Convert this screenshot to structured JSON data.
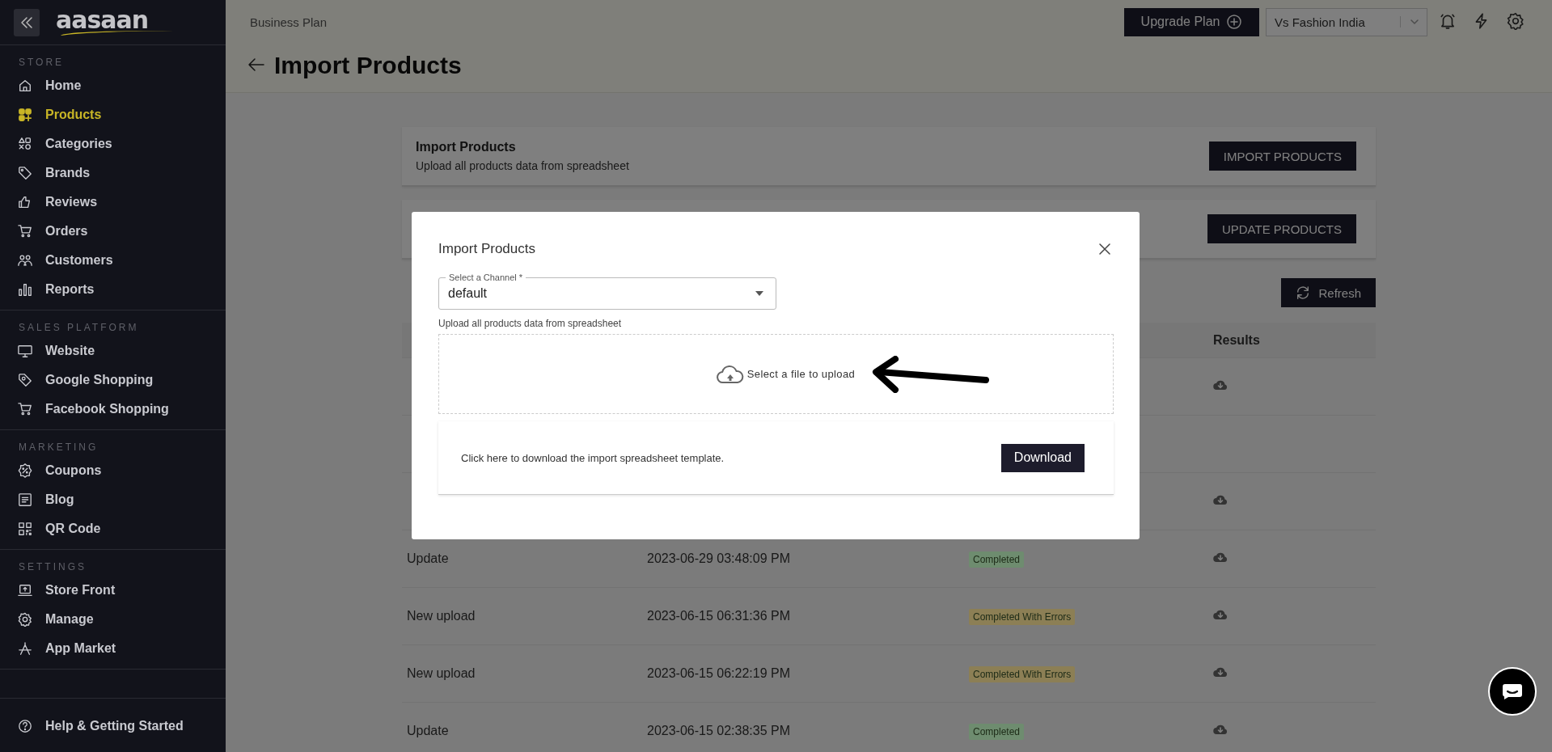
{
  "sidebar": {
    "logo": "aasaan",
    "sections": [
      {
        "title": "STORE",
        "items": [
          {
            "label": "Home",
            "selected": false
          },
          {
            "label": "Products",
            "selected": true
          },
          {
            "label": "Categories",
            "selected": false
          },
          {
            "label": "Brands",
            "selected": false
          },
          {
            "label": "Reviews",
            "selected": false
          },
          {
            "label": "Orders",
            "selected": false
          },
          {
            "label": "Customers",
            "selected": false
          },
          {
            "label": "Reports",
            "selected": false
          }
        ]
      },
      {
        "title": "SALES PLATFORM",
        "items": [
          {
            "label": "Website",
            "selected": false
          },
          {
            "label": "Google Shopping",
            "selected": false
          },
          {
            "label": "Facebook Shopping",
            "selected": false
          }
        ]
      },
      {
        "title": "MARKETING",
        "items": [
          {
            "label": "Coupons",
            "selected": false
          },
          {
            "label": "Blog",
            "selected": false
          },
          {
            "label": "QR Code",
            "selected": false
          }
        ]
      },
      {
        "title": "SETTINGS",
        "items": [
          {
            "label": "Store Front",
            "selected": false
          },
          {
            "label": "Manage",
            "selected": false
          },
          {
            "label": "App Market",
            "selected": false
          }
        ]
      }
    ],
    "footer": "Help & Getting Started"
  },
  "topbar": {
    "plan": "Business Plan",
    "upgrade_button": "Upgrade Plan",
    "store_select": "Vs Fashion India"
  },
  "page_title": "Import Products",
  "cards": [
    {
      "title": "Import Products",
      "subtitle": "Upload all products data from spreadsheet",
      "button": "IMPORT PRODUCTS"
    },
    {
      "button": "UPDATE PRODUCTS"
    }
  ],
  "refresh_button": "Refresh",
  "table": {
    "columns": [
      {
        "label": "Results"
      }
    ],
    "rows": [
      {
        "has_result": true
      },
      {
        "has_result": false
      },
      {
        "has_result": true
      },
      {
        "type": "Update",
        "date": "2023-06-29 03:48:09 PM",
        "status": "Completed",
        "color": "#6e8c6f",
        "has_result": true
      },
      {
        "type": "New upload",
        "date": "2023-06-15 06:31:36 PM",
        "status": "Completed With Errors",
        "color": "#8c7f55",
        "has_result": true
      },
      {
        "type": "New upload",
        "date": "2023-06-15 06:22:19 PM",
        "status": "Completed With Errors",
        "color": "#8c7f55",
        "has_result": true
      },
      {
        "type": "Update",
        "date": "2023-06-15 02:38:35 PM",
        "status": "Completed",
        "color": "#6e8c6f",
        "has_result": true
      }
    ]
  },
  "modal": {
    "title": "Import Products",
    "channel": {
      "label": "Select a Channel *",
      "value": "default"
    },
    "helper": "Upload all products data from spreadsheet",
    "dropzone": "Select a file to upload",
    "template_text": "Click here to download the import spreadsheet template.",
    "download_button": "Download"
  }
}
